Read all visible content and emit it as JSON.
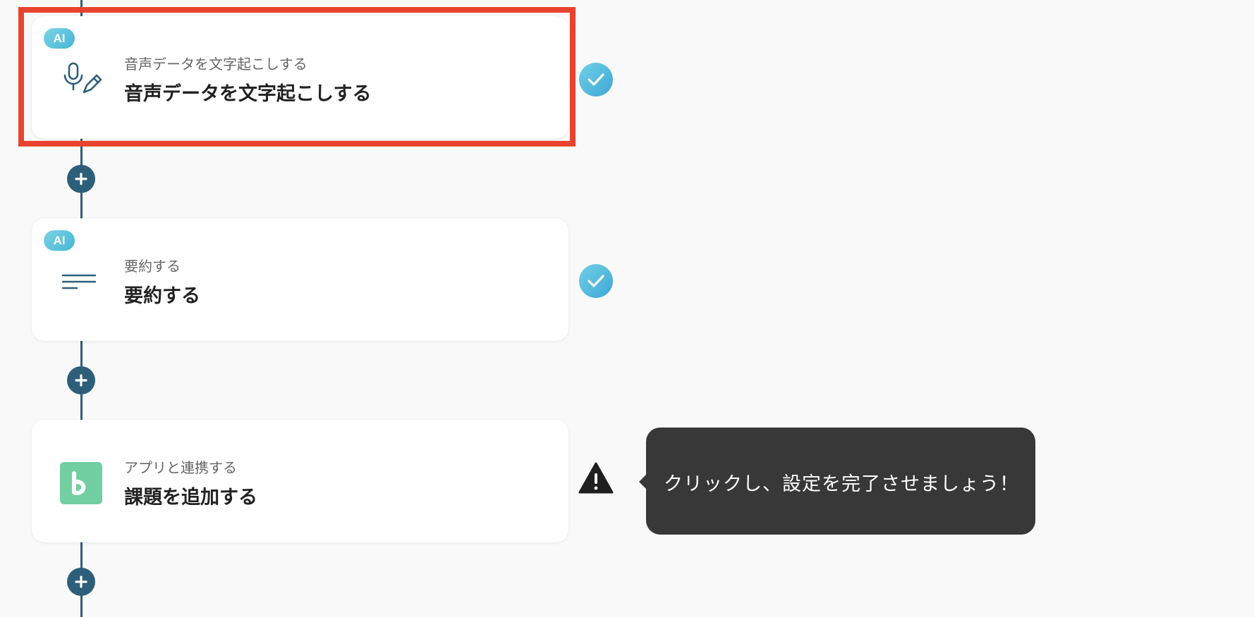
{
  "colors": {
    "background": "#f9f9f9",
    "timeline": "#2d5f7a",
    "highlight": "#e8432e",
    "ai_badge": "#47b6d6",
    "check": "#3fa7d6",
    "backlog_brand": "#72cfa1",
    "tooltip_bg": "#383838"
  },
  "steps": [
    {
      "badge": "AI",
      "icon": "mic-pencil-icon",
      "subtitle": "音声データを文字起こしする",
      "title": "音声データを文字起こしする",
      "status": "complete",
      "highlighted": true
    },
    {
      "badge": "AI",
      "icon": "summary-lines-icon",
      "subtitle": "要約する",
      "title": "要約する",
      "status": "complete",
      "highlighted": false
    },
    {
      "badge": "",
      "icon": "backlog-app-icon",
      "subtitle": "アプリと連携する",
      "title": "課題を追加する",
      "status": "warning",
      "highlighted": false
    }
  ],
  "tooltip": {
    "text": "クリックし、設定を完了させましょう！"
  }
}
